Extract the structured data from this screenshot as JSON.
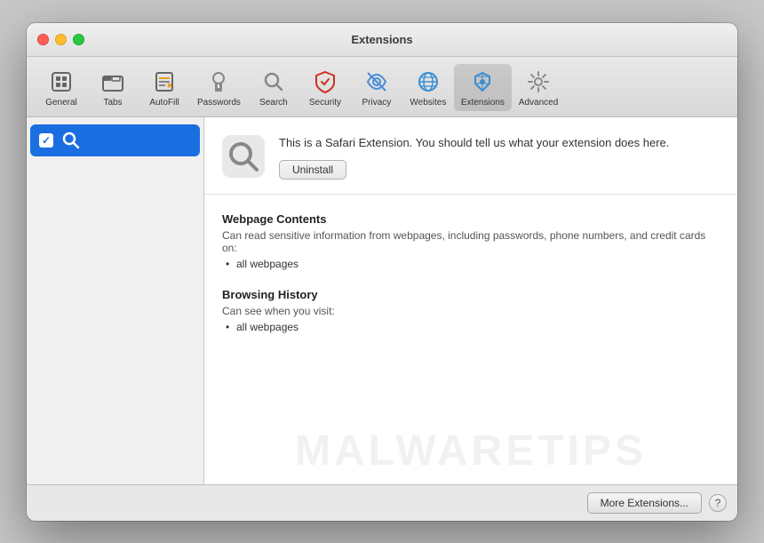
{
  "window": {
    "title": "Extensions"
  },
  "traffic_lights": {
    "close": "close",
    "minimize": "minimize",
    "maximize": "maximize"
  },
  "toolbar": {
    "items": [
      {
        "id": "general",
        "label": "General",
        "icon": "general"
      },
      {
        "id": "tabs",
        "label": "Tabs",
        "icon": "tabs"
      },
      {
        "id": "autofill",
        "label": "AutoFill",
        "icon": "autofill"
      },
      {
        "id": "passwords",
        "label": "Passwords",
        "icon": "passwords"
      },
      {
        "id": "search",
        "label": "Search",
        "icon": "search"
      },
      {
        "id": "security",
        "label": "Security",
        "icon": "security"
      },
      {
        "id": "privacy",
        "label": "Privacy",
        "icon": "privacy"
      },
      {
        "id": "websites",
        "label": "Websites",
        "icon": "websites"
      },
      {
        "id": "extensions",
        "label": "Extensions",
        "icon": "extensions",
        "active": true
      },
      {
        "id": "advanced",
        "label": "Advanced",
        "icon": "advanced"
      }
    ]
  },
  "sidebar": {
    "items": [
      {
        "id": "search-ext",
        "label": "",
        "selected": true,
        "checked": true
      }
    ]
  },
  "detail": {
    "extension_description": "This is a Safari Extension. You should tell us what your extension does here.",
    "uninstall_label": "Uninstall",
    "permissions": [
      {
        "title": "Webpage Contents",
        "description": "Can read sensitive information from webpages, including passwords, phone numbers, and credit cards on:",
        "items": [
          "all webpages"
        ]
      },
      {
        "title": "Browsing History",
        "description": "Can see when you visit:",
        "items": [
          "all webpages"
        ]
      }
    ]
  },
  "bottom_bar": {
    "more_extensions_label": "More Extensions...",
    "help_label": "?"
  },
  "watermark": {
    "text": "MALWARETIPS"
  }
}
